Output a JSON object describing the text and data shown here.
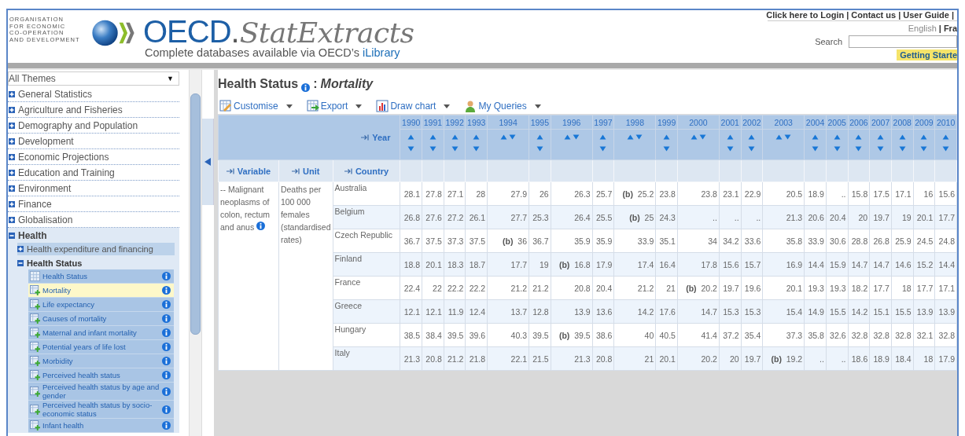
{
  "header": {
    "org_name": "ORGANISATION\nFOR ECONOMIC\nCO-OPERATION\nAND DEVELOPMENT",
    "brand": "OECD",
    "brand_suffix": ".",
    "product": "StatExtracts",
    "tagline": "Complete databases available via OECD’s",
    "tagline_link": "iLibrary",
    "top_links": [
      {
        "label": "Click here to Login",
        "sep": "|"
      },
      {
        "label": "Contact us",
        "sep": "|"
      },
      {
        "label": "User Guide",
        "sep": "|"
      }
    ],
    "languages": [
      {
        "label": "English",
        "selected": true,
        "sep": "|"
      },
      {
        "label": "Fra",
        "selected": false
      }
    ],
    "search": {
      "label": "Search"
    },
    "getting_started": "Getting Starte"
  },
  "sidebar": {
    "theme_select": "All Themes",
    "select_caret": "▼",
    "themes": [
      {
        "label": "General Statistics",
        "expanded": false
      },
      {
        "label": "Agriculture and Fisheries",
        "expanded": false
      },
      {
        "label": "Demography and Population",
        "expanded": false
      },
      {
        "label": "Development",
        "expanded": false
      },
      {
        "label": "Economic Projections",
        "expanded": false
      },
      {
        "label": "Education and Training",
        "expanded": false
      },
      {
        "label": "Environment",
        "expanded": false
      },
      {
        "label": "Finance",
        "expanded": false
      },
      {
        "label": "Globalisation",
        "expanded": false
      },
      {
        "label": "Health",
        "expanded": true,
        "children": [
          {
            "label": "Health expenditure and financing",
            "expanded": false
          },
          {
            "label": "Health Status",
            "expanded": true,
            "children": [
              {
                "label": "Health Status",
                "kind": "table",
                "selected": false
              },
              {
                "label": "Mortality",
                "kind": "query",
                "selected": true
              },
              {
                "label": "Life expectancy",
                "kind": "query",
                "selected": false
              },
              {
                "label": "Causes of mortality",
                "kind": "query",
                "selected": false
              },
              {
                "label": "Maternal and infant mortality",
                "kind": "query",
                "selected": false
              },
              {
                "label": "Potential years of life lost",
                "kind": "query",
                "selected": false
              },
              {
                "label": "Morbidity",
                "kind": "query",
                "selected": false
              },
              {
                "label": "Perceived health status",
                "kind": "query",
                "selected": false
              },
              {
                "label": "Perceived health status by age and gender",
                "kind": "query",
                "selected": false
              },
              {
                "label": "Perceived health status by socio-economic status",
                "kind": "query",
                "selected": false
              },
              {
                "label": "Infant health",
                "kind": "query",
                "selected": false
              }
            ]
          }
        ]
      }
    ]
  },
  "main": {
    "title": "Health Status",
    "title_sep": ":",
    "subtitle": "Mortality",
    "toolbar": [
      {
        "label": "Customise",
        "kind": "customise"
      },
      {
        "label": "Export",
        "kind": "export"
      },
      {
        "label": "Draw chart",
        "kind": "chart"
      },
      {
        "label": "My Queries",
        "kind": "queries"
      }
    ],
    "table": {
      "year_label": "Year",
      "dim_headers": [
        "Variable",
        "Unit",
        "Country"
      ],
      "years": [
        {
          "label": "1990",
          "flagged": false
        },
        {
          "label": "1991",
          "flagged": false
        },
        {
          "label": "1992",
          "flagged": false
        },
        {
          "label": "1993",
          "flagged": false
        },
        {
          "label": "1994",
          "flagged": true
        },
        {
          "label": "1995",
          "flagged": false
        },
        {
          "label": "1996",
          "flagged": true
        },
        {
          "label": "1997",
          "flagged": false
        },
        {
          "label": "1998",
          "flagged": true
        },
        {
          "label": "1999",
          "flagged": false
        },
        {
          "label": "2000",
          "flagged": true
        },
        {
          "label": "2001",
          "flagged": false
        },
        {
          "label": "2002",
          "flagged": false
        },
        {
          "label": "2003",
          "flagged": true
        },
        {
          "label": "2004",
          "flagged": false
        },
        {
          "label": "2005",
          "flagged": false
        },
        {
          "label": "2006",
          "flagged": false
        },
        {
          "label": "2007",
          "flagged": false
        },
        {
          "label": "2008",
          "flagged": false
        },
        {
          "label": "2009",
          "flagged": false
        },
        {
          "label": "2010",
          "flagged": false
        }
      ],
      "variable": "-- Malignant neoplasms of colon, rectum and anus",
      "unit": "Deaths per 100 000 females (standardised rates)",
      "rows": [
        {
          "country": "Australia",
          "values": [
            "28.1",
            "27.8",
            "27.1",
            "28",
            "27.9",
            "26",
            "26.3",
            "25.7",
            "**(b)**  25.2",
            "23.8",
            "23.8",
            "23.1",
            "22.9",
            "20.5",
            "18.9",
            "..",
            "15.8",
            "17.5",
            "17.1",
            "16",
            "15.6"
          ]
        },
        {
          "country": "Belgium",
          "values": [
            "26.8",
            "27.6",
            "27.2",
            "26.1",
            "27.7",
            "25.3",
            "26.4",
            "25.5",
            "**(b)**  25",
            "24.3",
            "..",
            "..",
            "..",
            "21.3",
            "20.6",
            "20.4",
            "20",
            "19.7",
            "19",
            "20.1",
            "17.7"
          ]
        },
        {
          "country": "Czech Republic",
          "values": [
            "36.7",
            "37.5",
            "37.3",
            "37.5",
            "**(b)**  36",
            "36.7",
            "35.9",
            "35.9",
            "33.9",
            "35.1",
            "34",
            "34.2",
            "33.6",
            "35.8",
            "33.9",
            "30.6",
            "28.8",
            "26.8",
            "25.9",
            "24.5",
            "24.8"
          ]
        },
        {
          "country": "Finland",
          "values": [
            "18.8",
            "20.1",
            "18.3",
            "18.7",
            "17.7",
            "19",
            "**(b)**  16.8",
            "17.9",
            "17.4",
            "16.4",
            "17.8",
            "15.6",
            "15.7",
            "16.9",
            "14.4",
            "15.9",
            "14.7",
            "14.7",
            "14.6",
            "15.2",
            "14.4"
          ]
        },
        {
          "country": "France",
          "values": [
            "22.4",
            "22",
            "22.2",
            "22.2",
            "21.2",
            "21.2",
            "20.8",
            "20.4",
            "21.2",
            "21",
            "**(b)**  20.2",
            "19.7",
            "19.6",
            "20.1",
            "19.3",
            "19.3",
            "18.2",
            "17.7",
            "18",
            "17.7",
            "17.1"
          ]
        },
        {
          "country": "Greece",
          "values": [
            "12.1",
            "12.1",
            "11.9",
            "12.4",
            "13.7",
            "12.8",
            "13.9",
            "13.6",
            "14.2",
            "17.6",
            "14.7",
            "15.3",
            "15.3",
            "15.4",
            "14.9",
            "15.5",
            "14.2",
            "15.1",
            "15.5",
            "13.9",
            "13.9"
          ]
        },
        {
          "country": "Hungary",
          "values": [
            "38.5",
            "38.4",
            "39.5",
            "39.6",
            "40.3",
            "39.5",
            "**(b)**  39.5",
            "38.6",
            "40",
            "40.5",
            "41.4",
            "37.2",
            "35.4",
            "37.3",
            "35.8",
            "32.6",
            "32.8",
            "32.8",
            "32.8",
            "32.1",
            "32.8"
          ]
        },
        {
          "country": "Italy",
          "values": [
            "21.3",
            "20.8",
            "21.2",
            "21.8",
            "22.1",
            "21.5",
            "21.3",
            "20.8",
            "21",
            "20.1",
            "20.2",
            "20",
            "19.7",
            "**(b)**  19.2",
            "..",
            "..",
            "18.6",
            "18.9",
            "18.4",
            "18",
            "17.9"
          ]
        }
      ]
    }
  }
}
